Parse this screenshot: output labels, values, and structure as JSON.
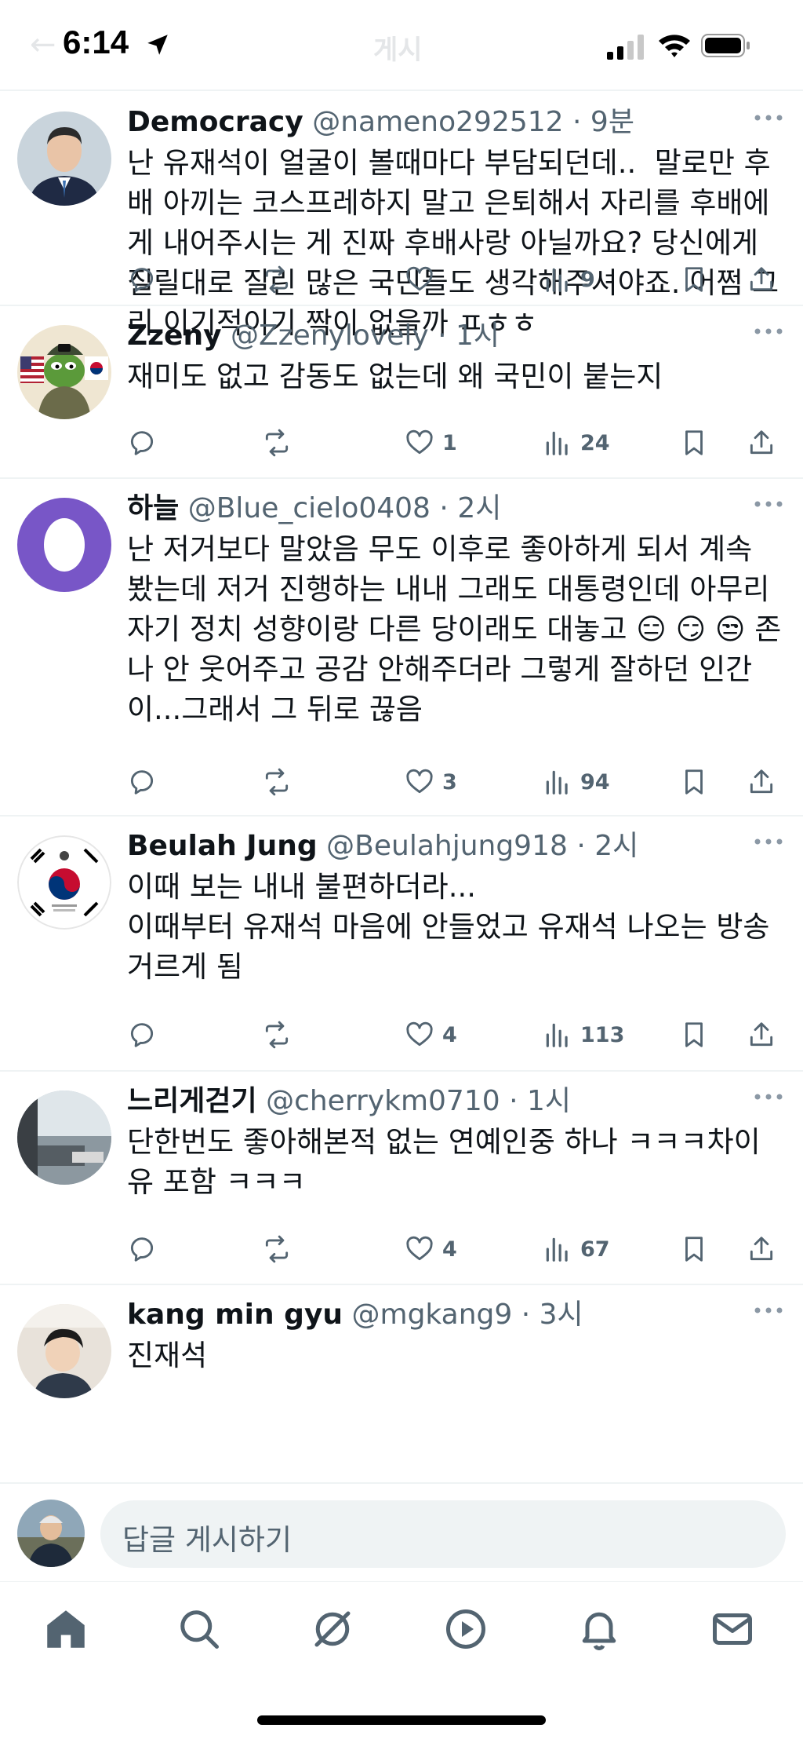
{
  "status_bar": {
    "time": "6:14",
    "ghost_title": "게시",
    "ghost_back": "←"
  },
  "tweets": [
    {
      "display_name": "Democracy",
      "handle": "@nameno292512",
      "time": "9분",
      "text": "난 유재석이 얼굴이 볼때마다 부담되던데..  말로만 후배 아끼는 코스프레하지 말고 은퇴해서 자리를 후배에게 내어주시는 게 진짜 후배사랑 아닐까요? 당신에게 질릴대로 질린 많은 국민들도 생각해주셔야죠. 어쩜 그리 이기적이기 짝이 없을까 ㅍㅎㅎ",
      "likes": "",
      "views": "9"
    },
    {
      "display_name": "Zzeny",
      "handle": "@Zzenylovely",
      "time": "1시",
      "text": "재미도 없고 감동도 없는데 왜 국민이 붙는지",
      "likes": "1",
      "views": "24"
    },
    {
      "display_name": "하늘",
      "handle": "@Blue_cielo0408",
      "time": "2시",
      "text": "난 저거보다 말았음 무도 이후로 좋아하게 되서 계속 봤는데 저거 진행하는 내내 그래도 대통령인데 아무리 자기 정치 성향이랑 다른 당이래도 대놓고 😑 😏 😒 존나 안 웃어주고 공감 안해주더라 그렇게 잘하던 인간이...그래서 그 뒤로 끊음",
      "likes": "3",
      "views": "94"
    },
    {
      "display_name": "Beulah Jung",
      "handle": "@Beulahjung918",
      "time": "2시",
      "text": "이때 보는 내내 불편하더라...\n이때부터 유재석 마음에 안들었고 유재석 나오는 방송 거르게 됨",
      "likes": "4",
      "views": "113"
    },
    {
      "display_name": "느리게걷기",
      "handle": "@cherrykm0710",
      "time": "1시",
      "text": "단한번도 좋아해본적 없는 연예인중 하나 ㅋㅋㅋ차이유 포함 ㅋㅋㅋ",
      "likes": "4",
      "views": "67"
    },
    {
      "display_name": "kang min gyu",
      "handle": "@mgkang9",
      "time": "3시",
      "text": "진재석",
      "likes": "",
      "views": ""
    }
  ],
  "reply_bar": {
    "placeholder": "답글 게시하기"
  },
  "nav": [
    "home-icon",
    "search-icon",
    "grok-icon",
    "video-icon",
    "notifications-icon",
    "messages-icon"
  ],
  "colors": {
    "text": "#0f1419",
    "secondary": "#536471",
    "divider": "#eff3f4"
  }
}
